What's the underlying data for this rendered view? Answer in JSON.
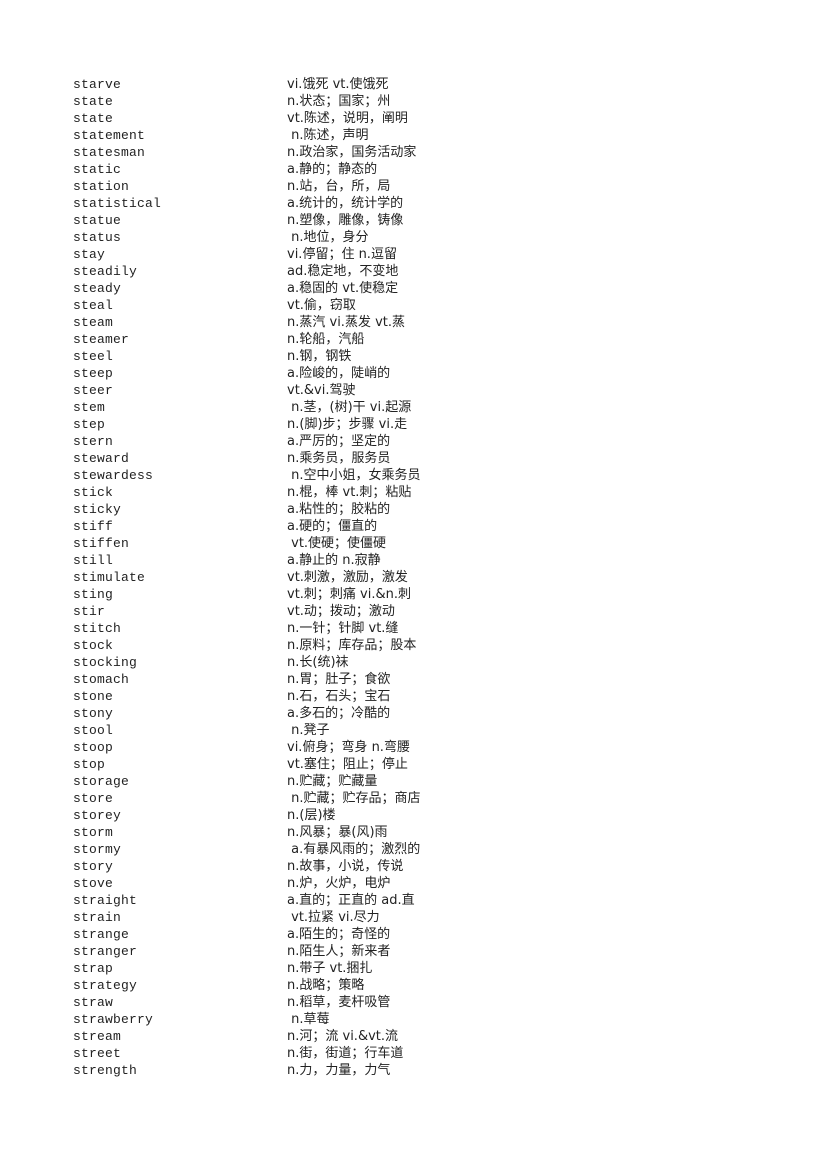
{
  "entries": [
    {
      "word": "starve",
      "def": "vi.饿死 vt.使饿死"
    },
    {
      "word": "state",
      "def": "n.状态；国家；州"
    },
    {
      "word": "state",
      "def": "vt.陈述，说明，阐明"
    },
    {
      "word": "statement",
      "def": " n.陈述，声明"
    },
    {
      "word": "statesman",
      "def": "n.政治家，国务活动家"
    },
    {
      "word": "static",
      "def": "a.静的；静态的"
    },
    {
      "word": "station",
      "def": "n.站，台，所，局"
    },
    {
      "word": "statistical",
      "def": "a.统计的，统计学的"
    },
    {
      "word": "statue",
      "def": "n.塑像，雕像，铸像"
    },
    {
      "word": "status",
      "def": " n.地位，身分"
    },
    {
      "word": "stay",
      "def": "vi.停留；住 n.逗留"
    },
    {
      "word": "steadily",
      "def": "ad.稳定地，不变地"
    },
    {
      "word": "steady",
      "def": "a.稳固的 vt.使稳定"
    },
    {
      "word": "steal",
      "def": "vt.偷，窃取"
    },
    {
      "word": "steam",
      "def": "n.蒸汽 vi.蒸发 vt.蒸"
    },
    {
      "word": "steamer",
      "def": "n.轮船，汽船"
    },
    {
      "word": "steel",
      "def": "n.钢，钢铁"
    },
    {
      "word": "steep",
      "def": "a.险峻的，陡峭的"
    },
    {
      "word": "steer",
      "def": "vt.&vi.驾驶"
    },
    {
      "word": "stem",
      "def": " n.茎，(树)干 vi.起源"
    },
    {
      "word": "step",
      "def": "n.(脚)步；步骤 vi.走"
    },
    {
      "word": "stern",
      "def": "a.严厉的；坚定的"
    },
    {
      "word": "steward",
      "def": "n.乘务员，服务员"
    },
    {
      "word": "stewardess",
      "def": " n.空中小姐，女乘务员"
    },
    {
      "word": "stick",
      "def": "n.棍，棒 vt.刺；粘贴"
    },
    {
      "word": "sticky",
      "def": "a.粘性的；胶粘的"
    },
    {
      "word": "stiff",
      "def": "a.硬的；僵直的"
    },
    {
      "word": "stiffen",
      "def": " vt.使硬；使僵硬"
    },
    {
      "word": "still",
      "def": "a.静止的 n.寂静"
    },
    {
      "word": "stimulate",
      "def": "vt.刺激，激励，激发"
    },
    {
      "word": "sting",
      "def": "vt.刺；刺痛 vi.&n.刺"
    },
    {
      "word": "stir",
      "def": "vt.动；拨动；激动"
    },
    {
      "word": "stitch",
      "def": "n.一针；针脚 vt.缝"
    },
    {
      "word": "stock",
      "def": "n.原料；库存品；股本"
    },
    {
      "word": "stocking",
      "def": "n.长(统)袜"
    },
    {
      "word": "stomach",
      "def": "n.胃；肚子；食欲"
    },
    {
      "word": "stone",
      "def": "n.石，石头；宝石"
    },
    {
      "word": "stony",
      "def": "a.多石的；冷酷的"
    },
    {
      "word": "stool",
      "def": " n.凳子"
    },
    {
      "word": "stoop",
      "def": "vi.俯身；弯身 n.弯腰"
    },
    {
      "word": "stop",
      "def": "vt.塞住；阻止；停止"
    },
    {
      "word": "storage",
      "def": "n.贮藏；贮藏量"
    },
    {
      "word": "store",
      "def": " n.贮藏；贮存品；商店"
    },
    {
      "word": "storey",
      "def": "n.(层)楼"
    },
    {
      "word": "storm",
      "def": "n.风暴；暴(风)雨"
    },
    {
      "word": "stormy",
      "def": " a.有暴风雨的；激烈的"
    },
    {
      "word": "story",
      "def": "n.故事，小说，传说"
    },
    {
      "word": "stove",
      "def": "n.炉，火炉，电炉"
    },
    {
      "word": "straight",
      "def": "a.直的；正直的 ad.直"
    },
    {
      "word": "strain",
      "def": " vt.拉紧 vi.尽力"
    },
    {
      "word": "strange",
      "def": "a.陌生的；奇怪的"
    },
    {
      "word": "stranger",
      "def": "n.陌生人；新来者"
    },
    {
      "word": "strap",
      "def": "n.带子 vt.捆扎"
    },
    {
      "word": "strategy",
      "def": "n.战略；策略"
    },
    {
      "word": "straw",
      "def": "n.稻草，麦杆吸管"
    },
    {
      "word": "strawberry",
      "def": " n.草莓"
    },
    {
      "word": "stream",
      "def": "n.河；流 vi.&vt.流"
    },
    {
      "word": "street",
      "def": "n.街，街道；行车道"
    },
    {
      "word": "strength",
      "def": "n.力，力量，力气"
    }
  ]
}
